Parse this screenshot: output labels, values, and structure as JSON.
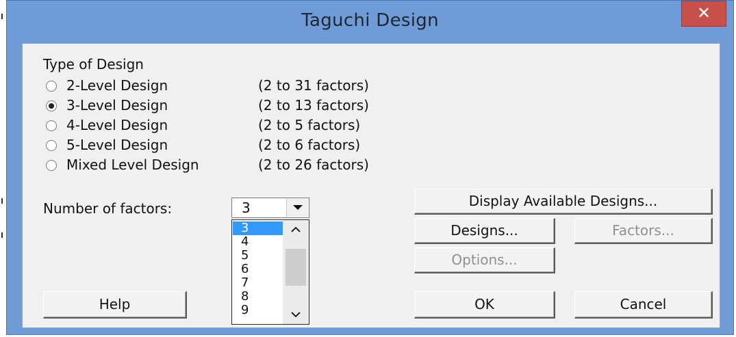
{
  "window": {
    "title": "Taguchi Design",
    "close_glyph": "✕"
  },
  "design_type": {
    "heading": "Type of Design",
    "selected_index": 1,
    "options": [
      {
        "label": "2-Level Design",
        "range": "(2 to 31 factors)"
      },
      {
        "label": "3-Level Design",
        "range": "(2 to 13 factors)"
      },
      {
        "label": "4-Level Design",
        "range": "(2 to 5 factors)"
      },
      {
        "label": "5-Level Design",
        "range": "(2 to 6 factors)"
      },
      {
        "label": "Mixed Level Design",
        "range": "(2 to 26 factors)"
      }
    ]
  },
  "factors": {
    "label": "Number of factors:",
    "value": "3",
    "list": [
      "3",
      "4",
      "5",
      "6",
      "7",
      "8",
      "9"
    ]
  },
  "buttons": {
    "display_available": "Display Available Designs...",
    "designs": "Designs...",
    "factors": "Factors...",
    "options": "Options...",
    "help": "Help",
    "ok": "OK",
    "cancel": "Cancel"
  },
  "colors": {
    "title_bar": "#6f9bd6",
    "close_button": "#c7504a",
    "client_bg": "#f0f0f0",
    "list_selection": "#3399ff"
  }
}
